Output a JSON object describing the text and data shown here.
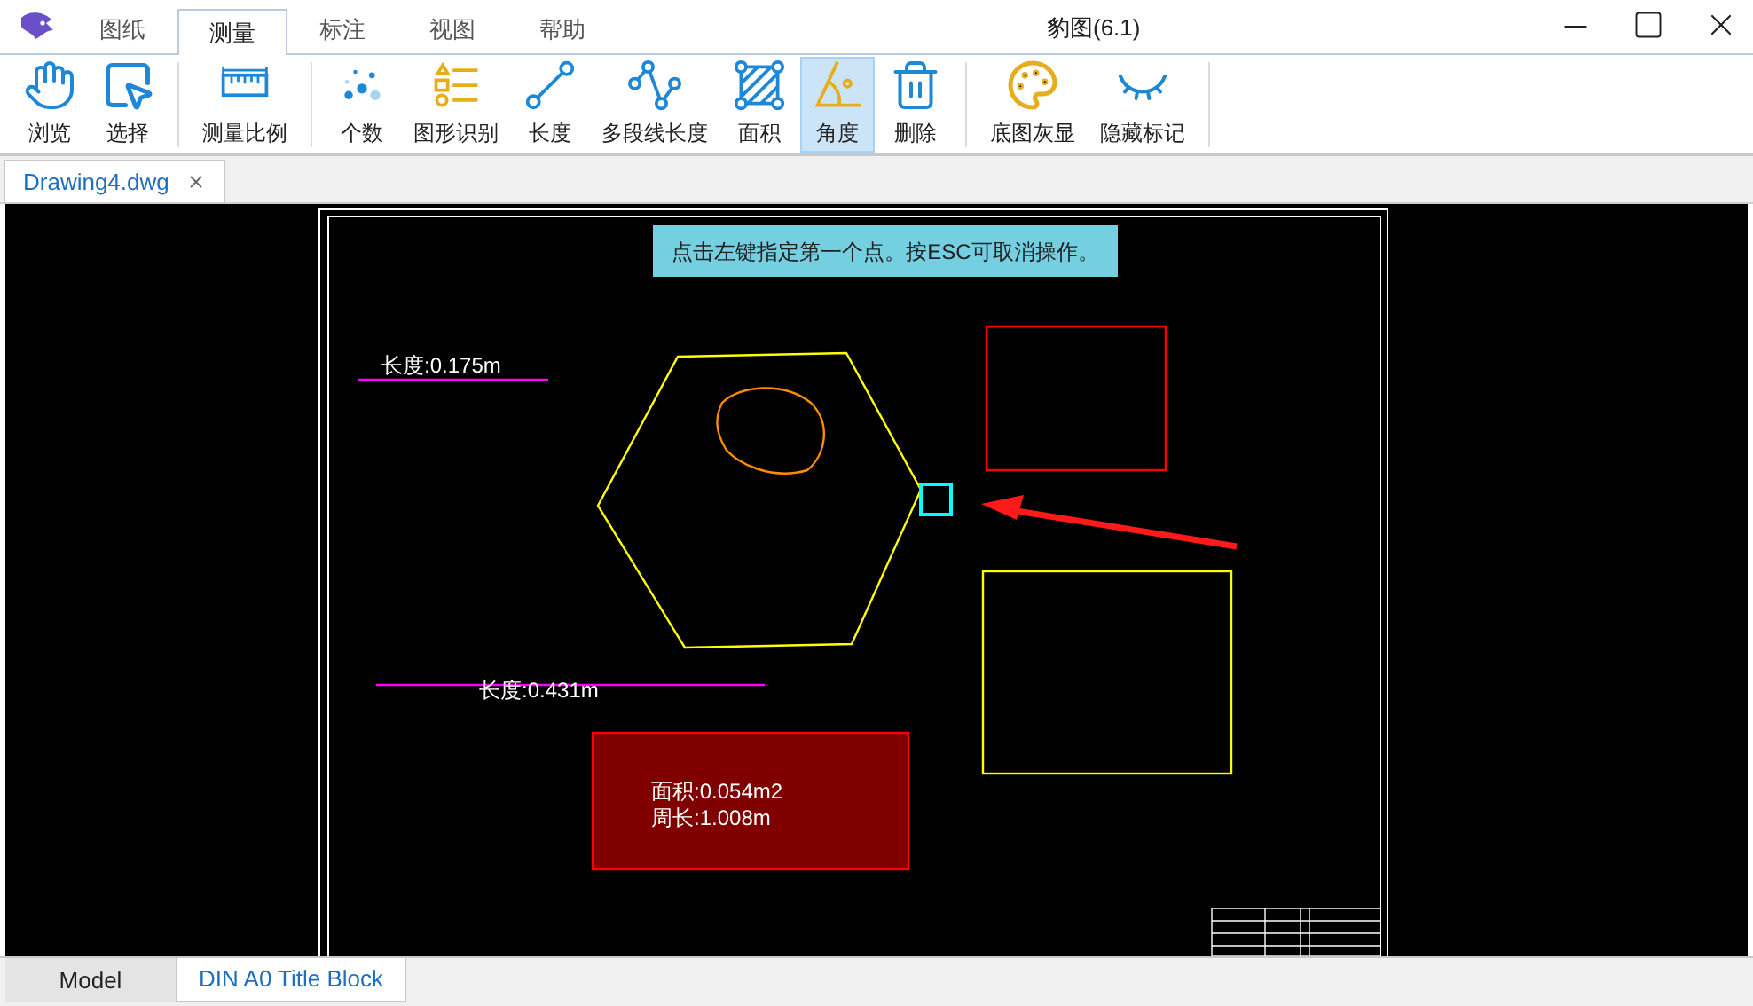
{
  "window": {
    "title": "豹图(6.1)"
  },
  "menu_tabs": [
    {
      "label": "图纸",
      "selected": false
    },
    {
      "label": "测量",
      "selected": true
    },
    {
      "label": "标注",
      "selected": false
    },
    {
      "label": "视图",
      "selected": false
    },
    {
      "label": "帮助",
      "selected": false
    }
  ],
  "toolbar_groups": [
    [
      {
        "label": "浏览",
        "kind": "hand",
        "selected": false
      },
      {
        "label": "选择",
        "kind": "select",
        "selected": false
      }
    ],
    [
      {
        "label": "测量比例",
        "kind": "ruler",
        "selected": false
      }
    ],
    [
      {
        "label": "个数",
        "kind": "dots",
        "selected": false
      },
      {
        "label": "图形识别",
        "kind": "shapes",
        "selected": false
      },
      {
        "label": "长度",
        "kind": "line",
        "selected": false
      },
      {
        "label": "多段线长度",
        "kind": "polyline",
        "selected": false
      },
      {
        "label": "面积",
        "kind": "area",
        "selected": false
      },
      {
        "label": "角度",
        "kind": "angle",
        "selected": true
      },
      {
        "label": "删除",
        "kind": "trash",
        "selected": false
      }
    ],
    [
      {
        "label": "底图灰显",
        "kind": "palette",
        "selected": false
      },
      {
        "label": "隐藏标记",
        "kind": "eye",
        "selected": false
      }
    ]
  ],
  "document_tabs": [
    {
      "label": "Drawing4.dwg",
      "selected": true
    }
  ],
  "canvas": {
    "hint": "点击左键指定第一个点。按ESC可取消操作。",
    "length_labels": [
      "长度:0.175m",
      "长度:0.431m"
    ],
    "area_labels": [
      "面积:0.054m2",
      "周长:1.008m"
    ]
  },
  "layout_tabs": [
    {
      "label": "Model",
      "selected": false
    },
    {
      "label": "DIN A0 Title Block",
      "selected": true
    }
  ]
}
